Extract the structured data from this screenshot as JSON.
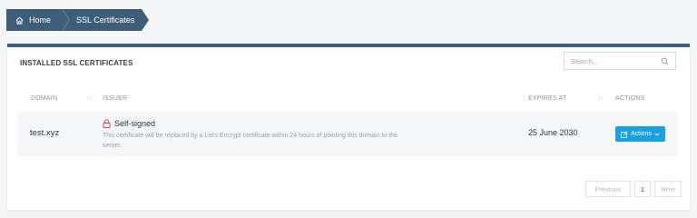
{
  "breadcrumb": {
    "home": "Home",
    "current": "SSL Certificates"
  },
  "panel": {
    "title": "INSTALLED SSL CERTIFICATES",
    "search_placeholder": "Search..."
  },
  "table": {
    "headers": {
      "domain": "DOMAIN",
      "issuer": "ISSUER",
      "expires": "EXPIRES AT",
      "actions": "ACTIONS"
    },
    "rows": [
      {
        "domain": "test.xyz",
        "issuer": "Self-signed",
        "description": "This certificate will be replaced by a Let's Encrypt certificate within 24 hours of pointing this domain to the server.",
        "expires": "25 June 2030",
        "action_label": "Actions"
      }
    ]
  },
  "pagination": {
    "previous": "Previous",
    "page": "1",
    "next": "Next"
  },
  "colors": {
    "header_bar": "#3f5d78",
    "accent_button": "#1a9fe0",
    "warning_red": "#e0474c"
  },
  "icons": {
    "home": "home-icon",
    "search": "search-icon",
    "lock": "lock-icon",
    "edit": "edit-icon",
    "caret": "chevron-down-icon"
  }
}
